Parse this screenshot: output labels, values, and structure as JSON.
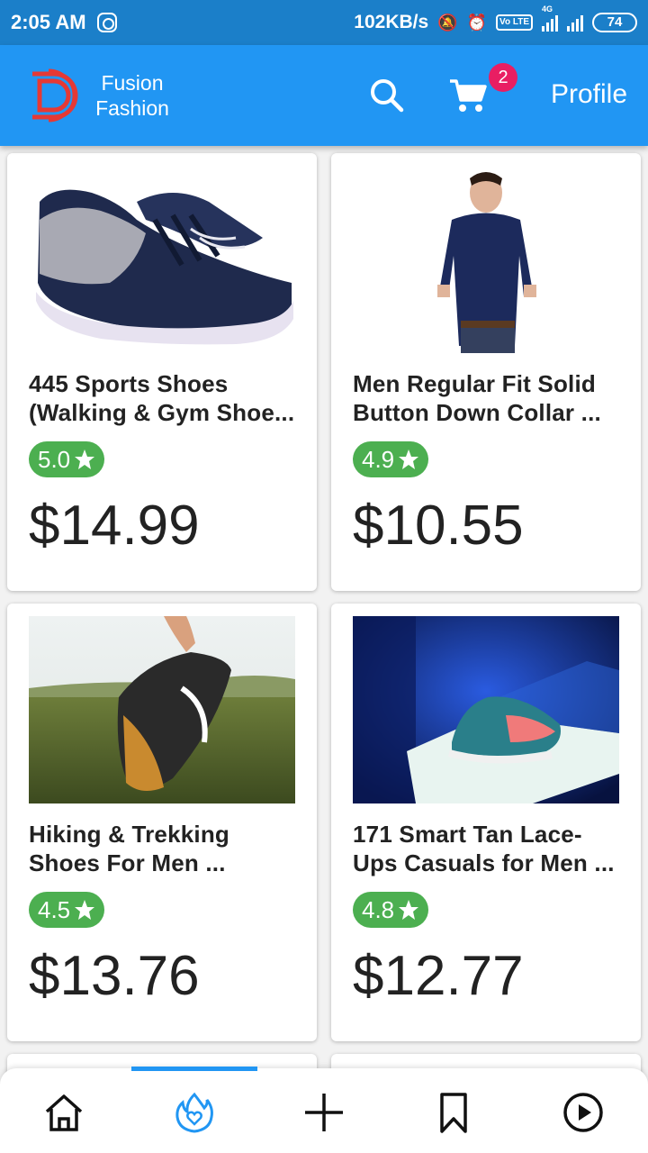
{
  "status_bar": {
    "time": "2:05 AM",
    "speed": "102KB/s",
    "network": "4G",
    "volte": "Vo LTE",
    "battery": "74"
  },
  "app_bar": {
    "brand_line1": "Fusion",
    "brand_line2": "Fashion",
    "cart_count": "2",
    "profile_label": "Profile"
  },
  "products": [
    {
      "title_line1": "445 Sports Shoes",
      "title_line2": "(Walking & Gym Shoe...",
      "rating": "5.0",
      "price": "$14.99",
      "image": "navy-sports-shoe"
    },
    {
      "title_line1": "Men Regular Fit Solid",
      "title_line2": "Button Down Collar ...",
      "rating": "4.9",
      "price": "$10.55",
      "image": "man-navy-shirt"
    },
    {
      "title_line1": "Hiking & Trekking",
      "title_line2": "Shoes For Men  ...",
      "rating": "4.5",
      "price": "$13.76",
      "image": "hand-holding-sneakers"
    },
    {
      "title_line1": "171 Smart Tan Lace-",
      "title_line2": "Ups Casuals for Men ...",
      "rating": "4.8",
      "price": "$12.77",
      "image": "sneaker-blue-light"
    }
  ],
  "colors": {
    "status_bar": "#1b7fc9",
    "app_bar": "#2196f3",
    "badge": "#e91e63",
    "rating": "#4caf50",
    "active_tab": "#2196f3"
  },
  "bottom_nav": {
    "items": [
      "home-icon",
      "trending-flame-icon",
      "add-icon",
      "bookmark-icon",
      "play-circle-icon"
    ],
    "active": "trending-flame-icon"
  }
}
